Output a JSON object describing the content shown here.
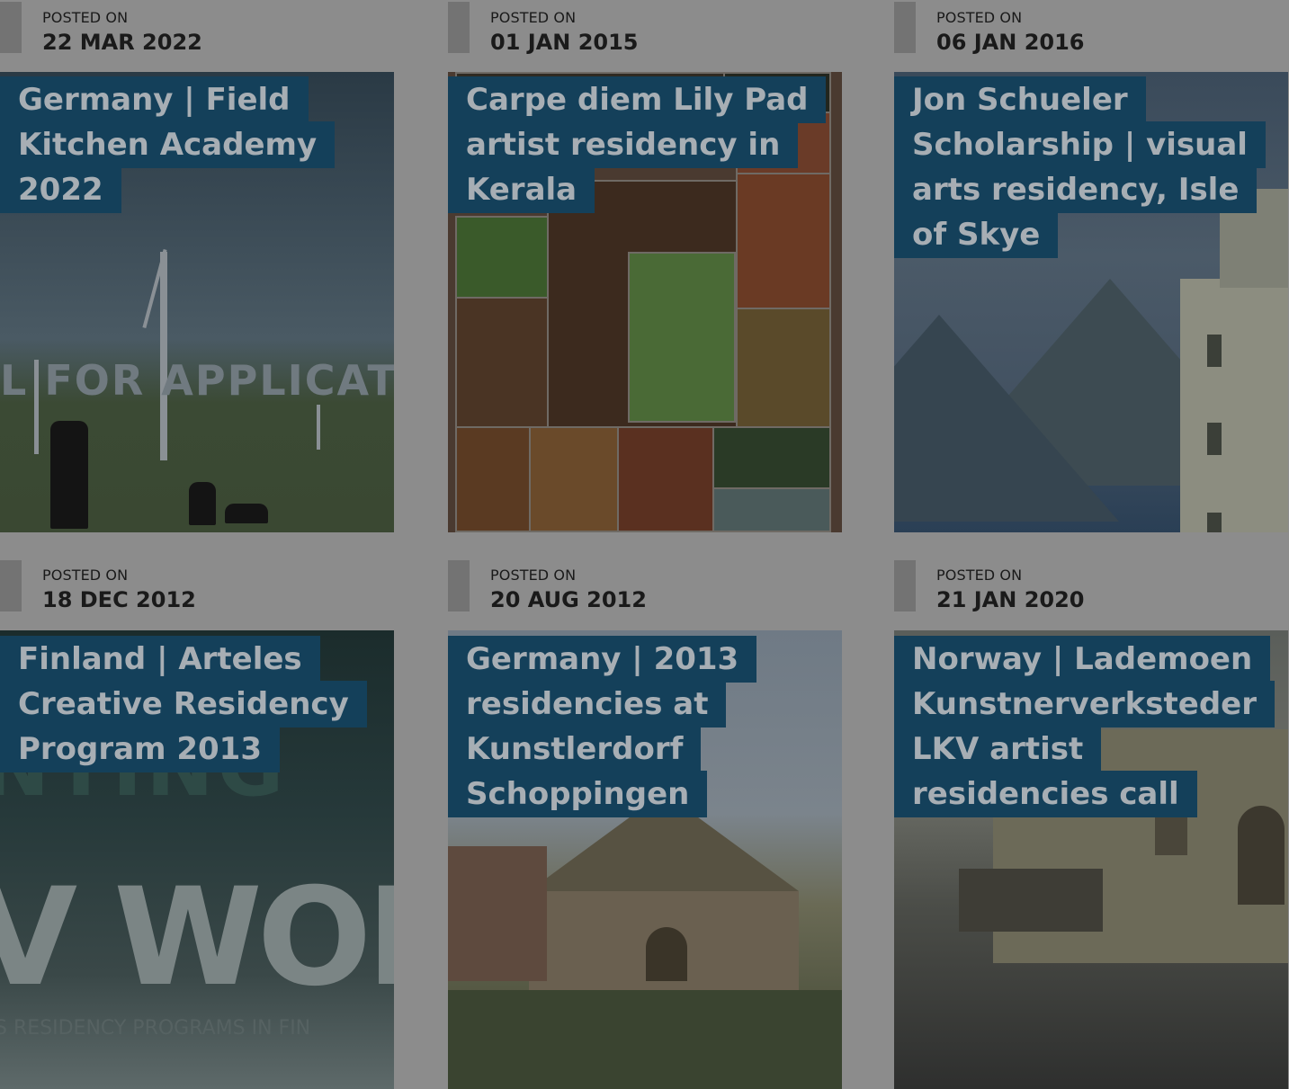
{
  "posts": [
    {
      "posted_on_label": "POSTED ON",
      "date": "22 MAR 2022",
      "title": "Germany | Field Kitchen Academy 2022",
      "image_text": "L FOR APPLICATI"
    },
    {
      "posted_on_label": "POSTED ON",
      "date": "01 JAN 2015",
      "title": "Carpe diem Lily Pad artist residency in Kerala"
    },
    {
      "posted_on_label": "POSTED ON",
      "date": "06 JAN 2016",
      "title": "Jon Schueler Scholarship | visual arts residency, Isle of Skye"
    },
    {
      "posted_on_label": "POSTED ON",
      "date": "18 DEC 2012",
      "title": "Finland | Arteles Creative Residency Program 2013",
      "image_text_top": "NTING",
      "image_text_big": "V WOR",
      "image_text_small": "S RESIDENCY PROGRAMS IN FIN"
    },
    {
      "posted_on_label": "POSTED ON",
      "date": "20 AUG 2012",
      "title": "Germany | 2013 residencies at Kunstlerdorf Schoppingen"
    },
    {
      "posted_on_label": "POSTED ON",
      "date": "21 JAN 2020",
      "title": "Norway | Lademoen Kunstnerverksteder LKV artist residencies call"
    }
  ]
}
